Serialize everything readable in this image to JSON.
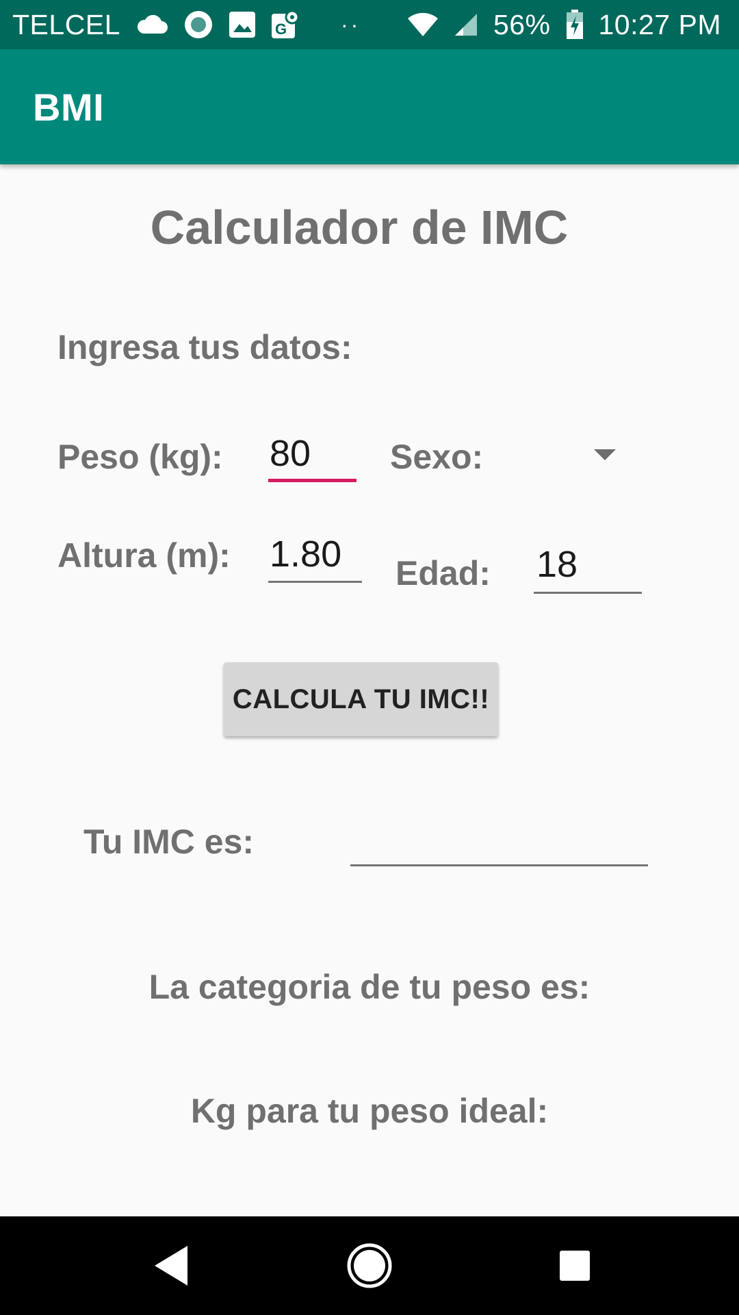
{
  "status_bar": {
    "carrier": "TELCEL",
    "battery": "56%",
    "time": "10:27 PM",
    "icons": [
      "cloud-icon",
      "circle-notification-icon",
      "image-icon",
      "maps-icon",
      "more-dots-icon",
      "wifi-icon",
      "cell-signal-icon",
      "battery-charging-icon"
    ]
  },
  "app_bar": {
    "title": "BMI"
  },
  "form": {
    "title": "Calculador de IMC",
    "section_label": "Ingresa tus datos:",
    "weight_label": "Peso (kg):",
    "weight_value": "80",
    "sex_label": "Sexo:",
    "sex_value": "",
    "height_label": "Altura (m):",
    "height_value": "1.80",
    "age_label": "Edad:",
    "age_value": "18",
    "calculate_button": "CALCULA TU IMC!!"
  },
  "results": {
    "bmi_label": "Tu IMC es:",
    "bmi_value": "",
    "category_label": "La categoria de tu peso es:",
    "ideal_label": "Kg para tu peso ideal:"
  },
  "nav_bar": {
    "icons": [
      "back-icon",
      "home-icon",
      "recents-icon"
    ]
  },
  "colors": {
    "status_bar": "#00695c",
    "app_bar": "#00897b",
    "accent": "#d81b60",
    "label_text": "#707070",
    "button": "#d6d6d6"
  }
}
